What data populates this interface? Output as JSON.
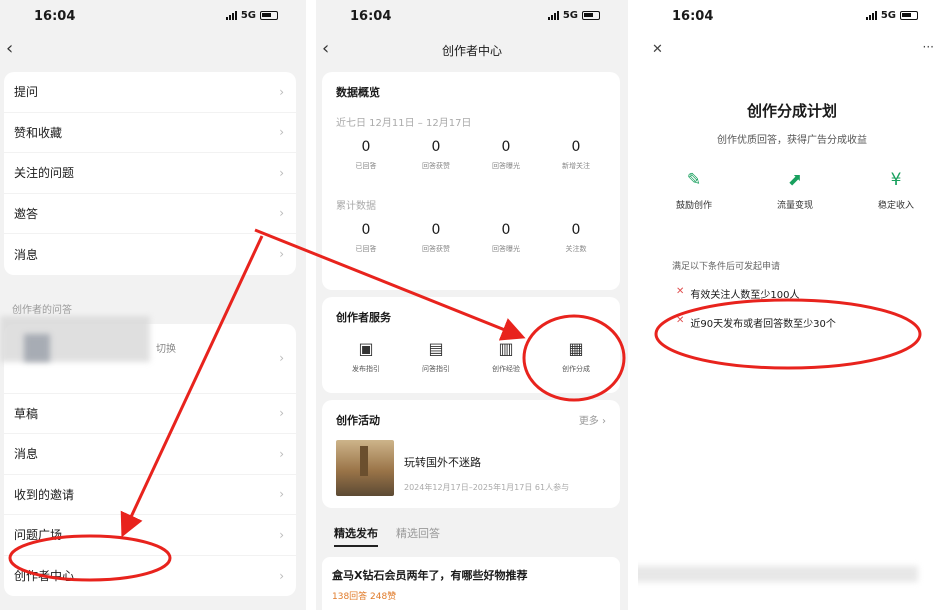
{
  "status": {
    "time": "16:04",
    "network": "5G"
  },
  "p1": {
    "back": "‹",
    "menu": [
      "提问",
      "赞和收藏",
      "关注的问题",
      "邀答",
      "消息"
    ],
    "section": "创作者的问答",
    "blur_tail": "切换",
    "menu2": [
      "草稿",
      "消息",
      "收到的邀请",
      "问题广场",
      "创作者中心"
    ],
    "chevron": "›"
  },
  "p2": {
    "back": "‹",
    "title": "创作者中心",
    "overview": "数据概览",
    "period": "近七日  12月11日 – 12月17日",
    "week": [
      {
        "n": "0",
        "l": "已回答"
      },
      {
        "n": "0",
        "l": "回答获赞"
      },
      {
        "n": "0",
        "l": "回答曝光"
      },
      {
        "n": "0",
        "l": "新增关注"
      }
    ],
    "cumulative": "累计数据",
    "total": [
      {
        "n": "0",
        "l": "已回答"
      },
      {
        "n": "0",
        "l": "回答获赞"
      },
      {
        "n": "0",
        "l": "回答曝光"
      },
      {
        "n": "0",
        "l": "关注数"
      }
    ],
    "services_title": "创作者服务",
    "services": [
      {
        "icon": "▣",
        "l": "发布指引"
      },
      {
        "icon": "▤",
        "l": "问答指引"
      },
      {
        "icon": "▥",
        "l": "创作经验"
      },
      {
        "icon": "▦",
        "l": "创作分成"
      }
    ],
    "activity_title": "创作活动",
    "more": "更多 ›",
    "activity_name": "玩转国外不迷路",
    "activity_meta": "2024年12月17日–2025年1月17日  61人参与",
    "tab_on": "精选发布",
    "tab_off": "精选回答",
    "post_title": "盒马X钻石会员两年了，有哪些好物推荐",
    "post_meta": "138回答  248赞"
  },
  "p3": {
    "close": "✕",
    "more": "···",
    "title": "创作分成计划",
    "subtitle": "创作优质回答，获得广告分成收益",
    "features": [
      {
        "icon": "✎",
        "l": "鼓励创作"
      },
      {
        "icon": "⬈",
        "l": "流量变现"
      },
      {
        "icon": "¥",
        "l": "稳定收入"
      }
    ],
    "conditions_title": "满足以下条件后可发起申请",
    "conditions": [
      "有效关注人数至少100人",
      "近90天发布或者回答数至少30个"
    ],
    "mark": "✕"
  },
  "colors": {
    "annotation": "#e8231d",
    "green": "#19a05e"
  }
}
